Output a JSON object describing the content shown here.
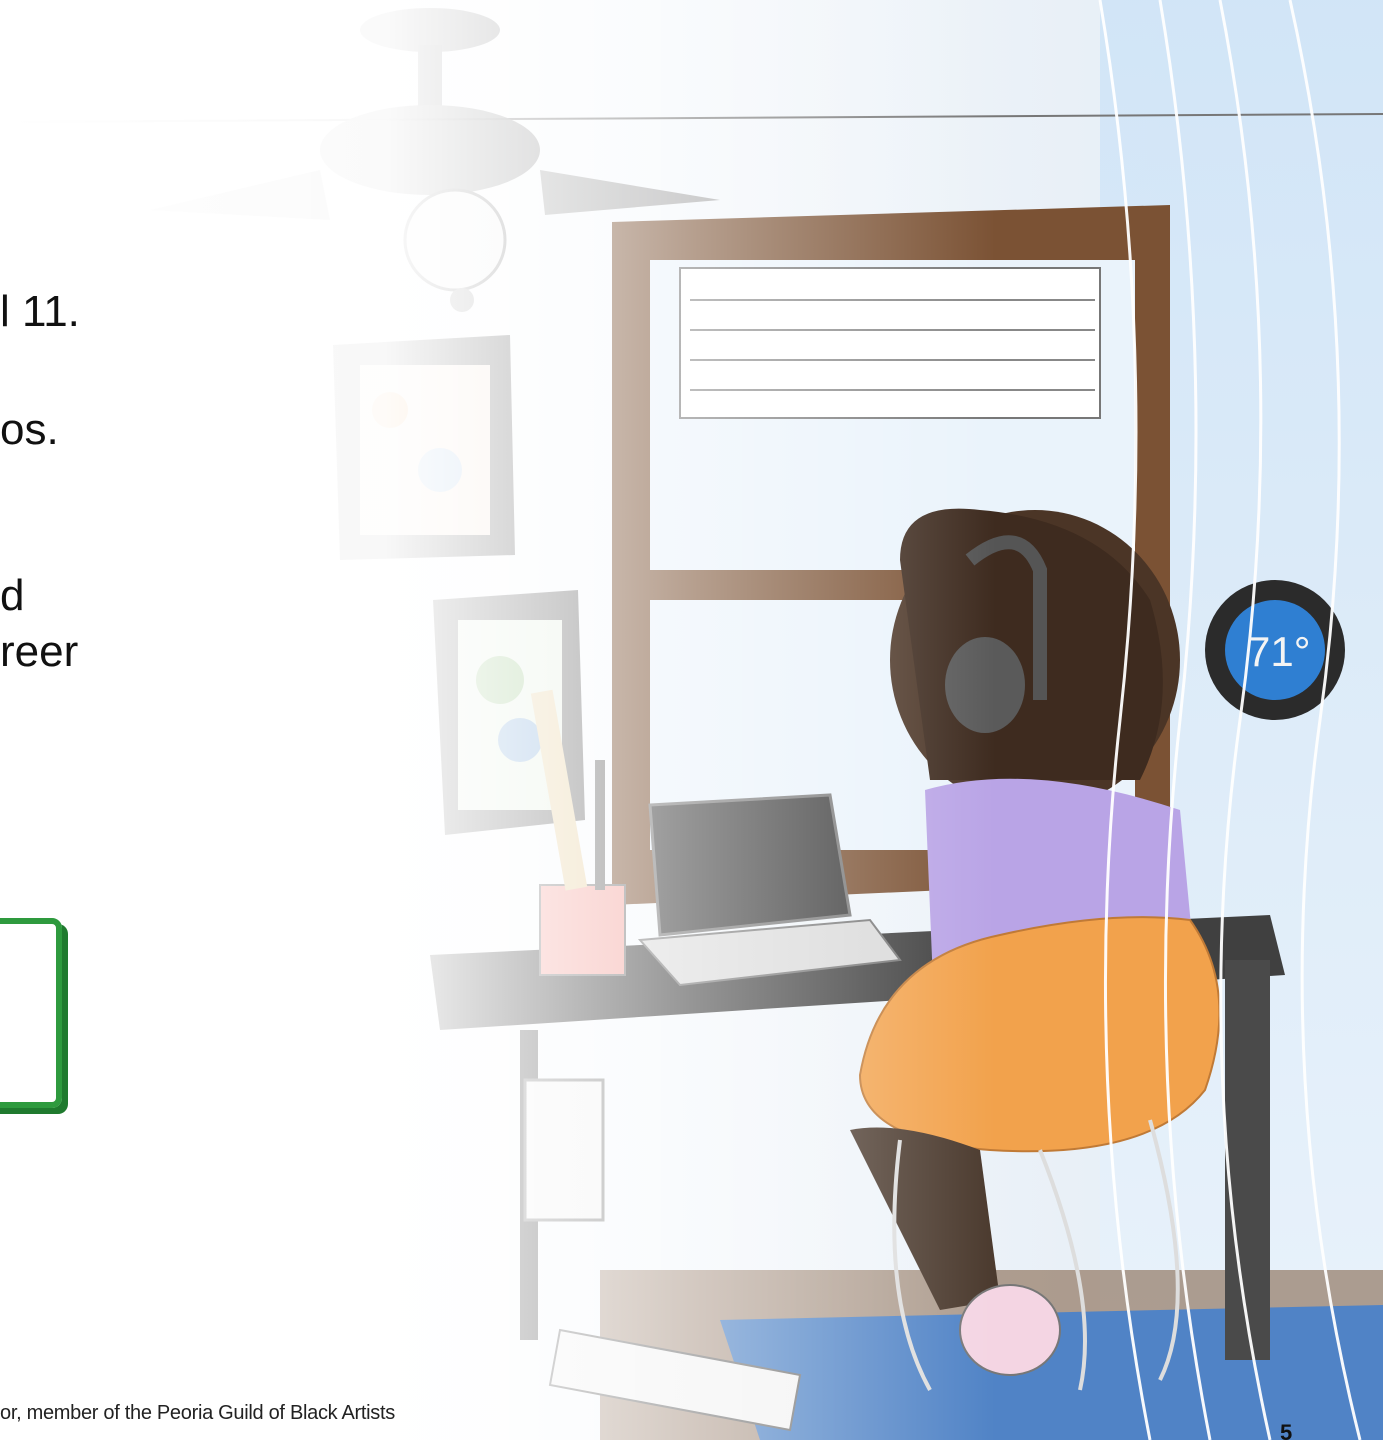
{
  "slide": {
    "text_lines": [
      "l 11.",
      "os.",
      "d",
      "reer"
    ],
    "caption": "or, member of the Peoria Guild of Black Artists",
    "page_number": "5"
  },
  "illustration": {
    "thermostat_reading": "71°",
    "colors": {
      "chair": "#f2a24c",
      "sweater": "#b9a4e6",
      "rug": "#3f7fd0",
      "window_frame": "#7b5234",
      "thermostat": "#2f7fd2",
      "green_box": "#2e9a3e"
    }
  }
}
